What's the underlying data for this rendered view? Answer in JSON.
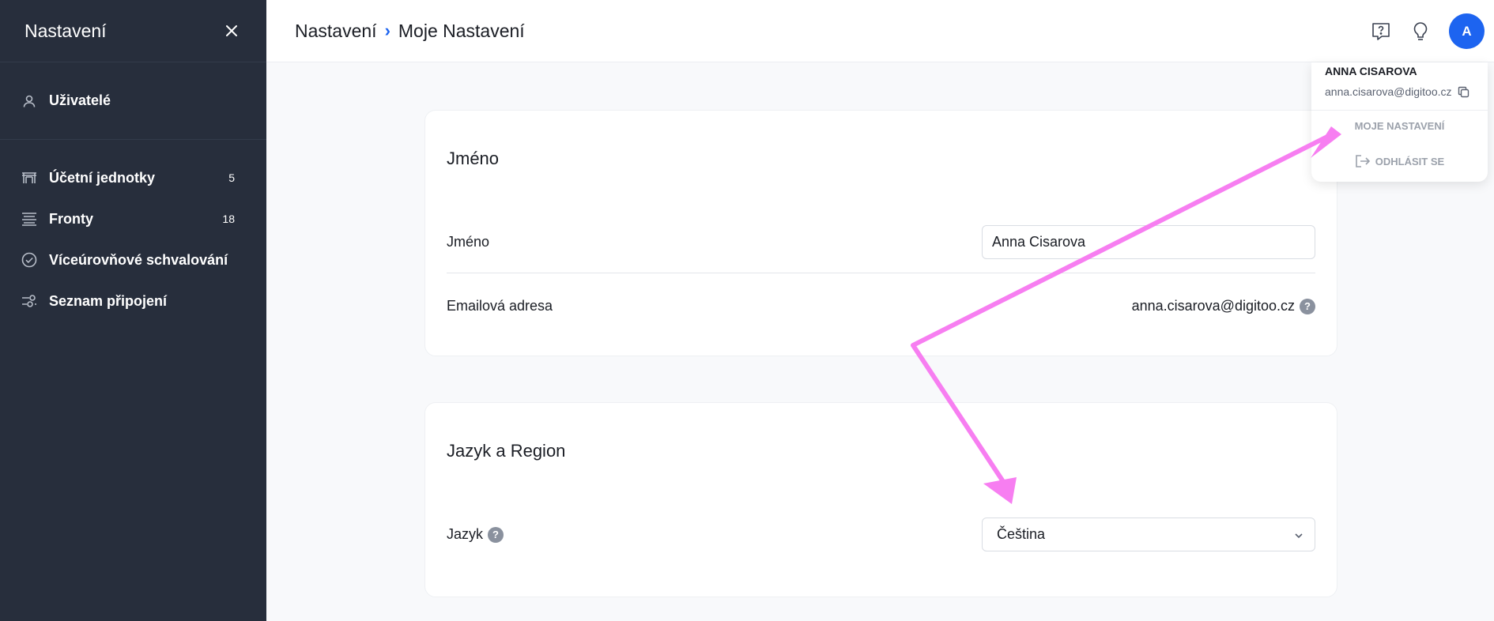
{
  "sidebar": {
    "title": "Nastavení",
    "close_icon": "close-icon",
    "top_item": {
      "label": "Uživatelé",
      "icon": "user-icon"
    },
    "items": [
      {
        "label": "Účetní jednotky",
        "count": "5",
        "icon": "building-icon"
      },
      {
        "label": "Fronty",
        "count": "18",
        "icon": "queue-icon"
      },
      {
        "label": "Víceúrovňové schvalování",
        "count": "",
        "icon": "check-circle-icon"
      },
      {
        "label": "Seznam připojení",
        "count": "",
        "icon": "connections-icon"
      }
    ]
  },
  "header": {
    "breadcrumb": [
      "Nastavení",
      "Moje Nastavení"
    ],
    "separator": "›",
    "avatar_initial": "A",
    "accent": "#1d64f0"
  },
  "name_card": {
    "title": "Jméno",
    "name_label": "Jméno",
    "name_value": "Anna Cisarova",
    "email_label": "Emailová adresa",
    "email_value": "anna.cisarova@digitoo.cz",
    "help": "?"
  },
  "lang_card": {
    "title": "Jazyk a Region",
    "lang_label": "Jazyk",
    "help": "?",
    "lang_value": "Čeština"
  },
  "user_menu": {
    "name": "ANNA CISAROVA",
    "email": "anna.cisarova@digitoo.cz",
    "settings": "MOJE NASTAVENÍ",
    "logout": "ODHLÁSIT SE"
  },
  "annotation_color": "#f77ef1"
}
